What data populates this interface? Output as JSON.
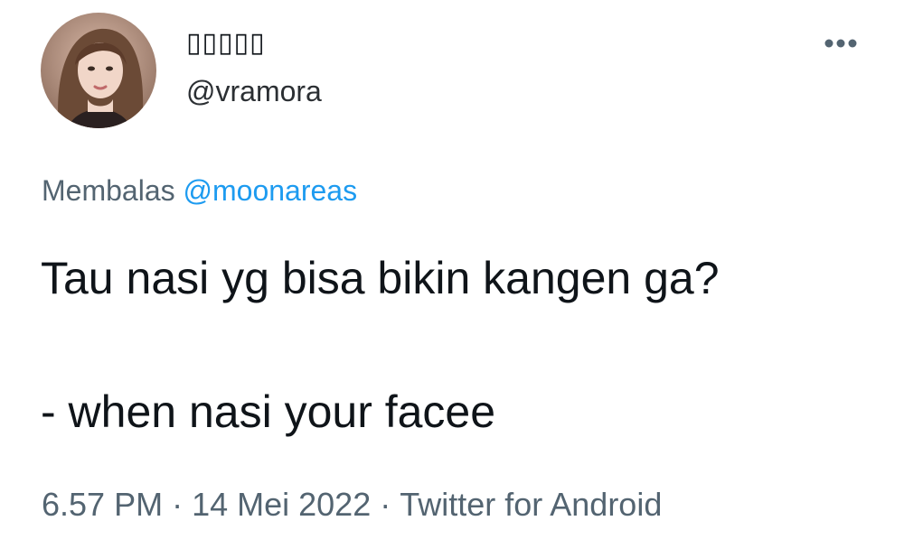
{
  "tweet": {
    "author": {
      "display_name": "▯▯▯▯▯",
      "handle": "@vramora",
      "avatar_icon": "user-avatar-photo"
    },
    "more_icon": "more-dots-icon",
    "reply_prefix": "Membalas",
    "reply_to": "@moonareas",
    "text_line_1": "Tau nasi yg bisa bikin kangen ga?",
    "text_line_2": "- when nasi your facee",
    "time": "6.57 PM",
    "date": "14 Mei 2022",
    "source": "Twitter for Android",
    "separator": "·"
  },
  "colors": {
    "text_primary": "#0f1419",
    "text_secondary": "#536471",
    "link": "#1d9bf0",
    "background": "#ffffff"
  }
}
